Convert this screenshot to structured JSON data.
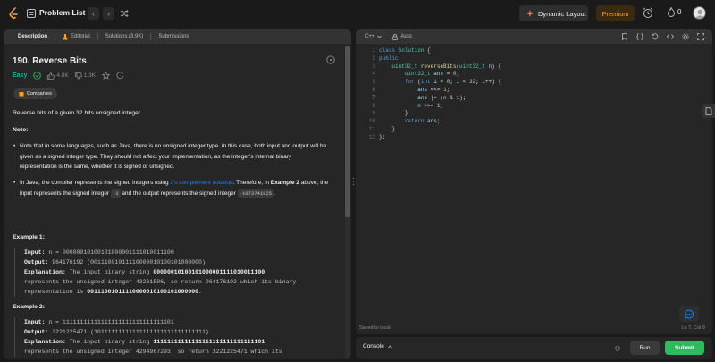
{
  "topbar": {
    "problem_list_label": "Problem List",
    "prev_label": "‹",
    "next_label": "›",
    "dynamic_layout_label": "Dynamic Layout",
    "premium_label": "Premium",
    "streak_count": "0"
  },
  "left_tabs": [
    {
      "label": "Description"
    },
    {
      "label": "Editorial"
    },
    {
      "label": "Solutions (3.9K)"
    },
    {
      "label": "Submissions"
    }
  ],
  "problem": {
    "title": "190. Reverse Bits",
    "difficulty": "Easy",
    "likes": "4.8K",
    "dislikes": "1.3K",
    "companies_label": "Companies",
    "statement": "Reverse bits of a given 32 bits unsigned integer.",
    "note_label": "Note:",
    "note1": "Note that in some languages, such as Java, there is no unsigned integer type. In this case, both input and output will be given as a signed integer type. They should not affect your implementation, as the integer's internal binary representation is the same, whether it is signed or unsigned.",
    "note2_a": "In Java, the compiler represents the signed integers using ",
    "note2_link": "2's complement notation",
    "note2_b": ". Therefore, in ",
    "note2_bold": "Example 2",
    "note2_c": " above, the input represents the signed integer ",
    "note2_code1": "-3",
    "note2_d": " and the output represents the signed integer ",
    "note2_code2": "-1073741825",
    "note2_e": "."
  },
  "examples": [
    {
      "heading": "Example 1:",
      "input_label": "Input:",
      "input": "n = 00000010100101000001111010011100",
      "output_label": "Output:",
      "output": "964176192 (00111001011110000010100101000000)",
      "explanation_label": "Explanation:",
      "explanation_a": "The input binary string ",
      "explanation_bold1": "00000010100101000001111010011100",
      "explanation_b": "represents the unsigned integer 43261596, so return 964176192 which its binary",
      "explanation_c": "representation is ",
      "explanation_bold2": "00111001011110000010100101000000",
      "explanation_d": "."
    },
    {
      "heading": "Example 2:",
      "input_label": "Input:",
      "input": "n = 11111111111111111111111111111101",
      "output_label": "Output:",
      "output": "3221225471 (10111111111111111111111111111111)",
      "explanation_label": "Explanation:",
      "explanation_a": "The input binary string ",
      "explanation_bold1": "11111111111111111111111111111101",
      "explanation_b": "represents the unsigned integer 4294967293, so return 3221225471 which its"
    }
  ],
  "editor": {
    "language": "C++",
    "mode": "Auto",
    "saved_status": "Saved to local",
    "cursor_position": "Ln 7, Col 9",
    "line_numbers": [
      "1",
      "2",
      "3",
      "4",
      "5",
      "6",
      "7",
      "8",
      "9",
      "10",
      "11",
      "12"
    ]
  },
  "console": {
    "label": "Console",
    "run_label": "Run",
    "submit_label": "Submit"
  },
  "colors": {
    "easy": "#00b8a3",
    "premium": "#ffa116",
    "submit": "#2cbb5d",
    "link": "#0a84ff"
  }
}
